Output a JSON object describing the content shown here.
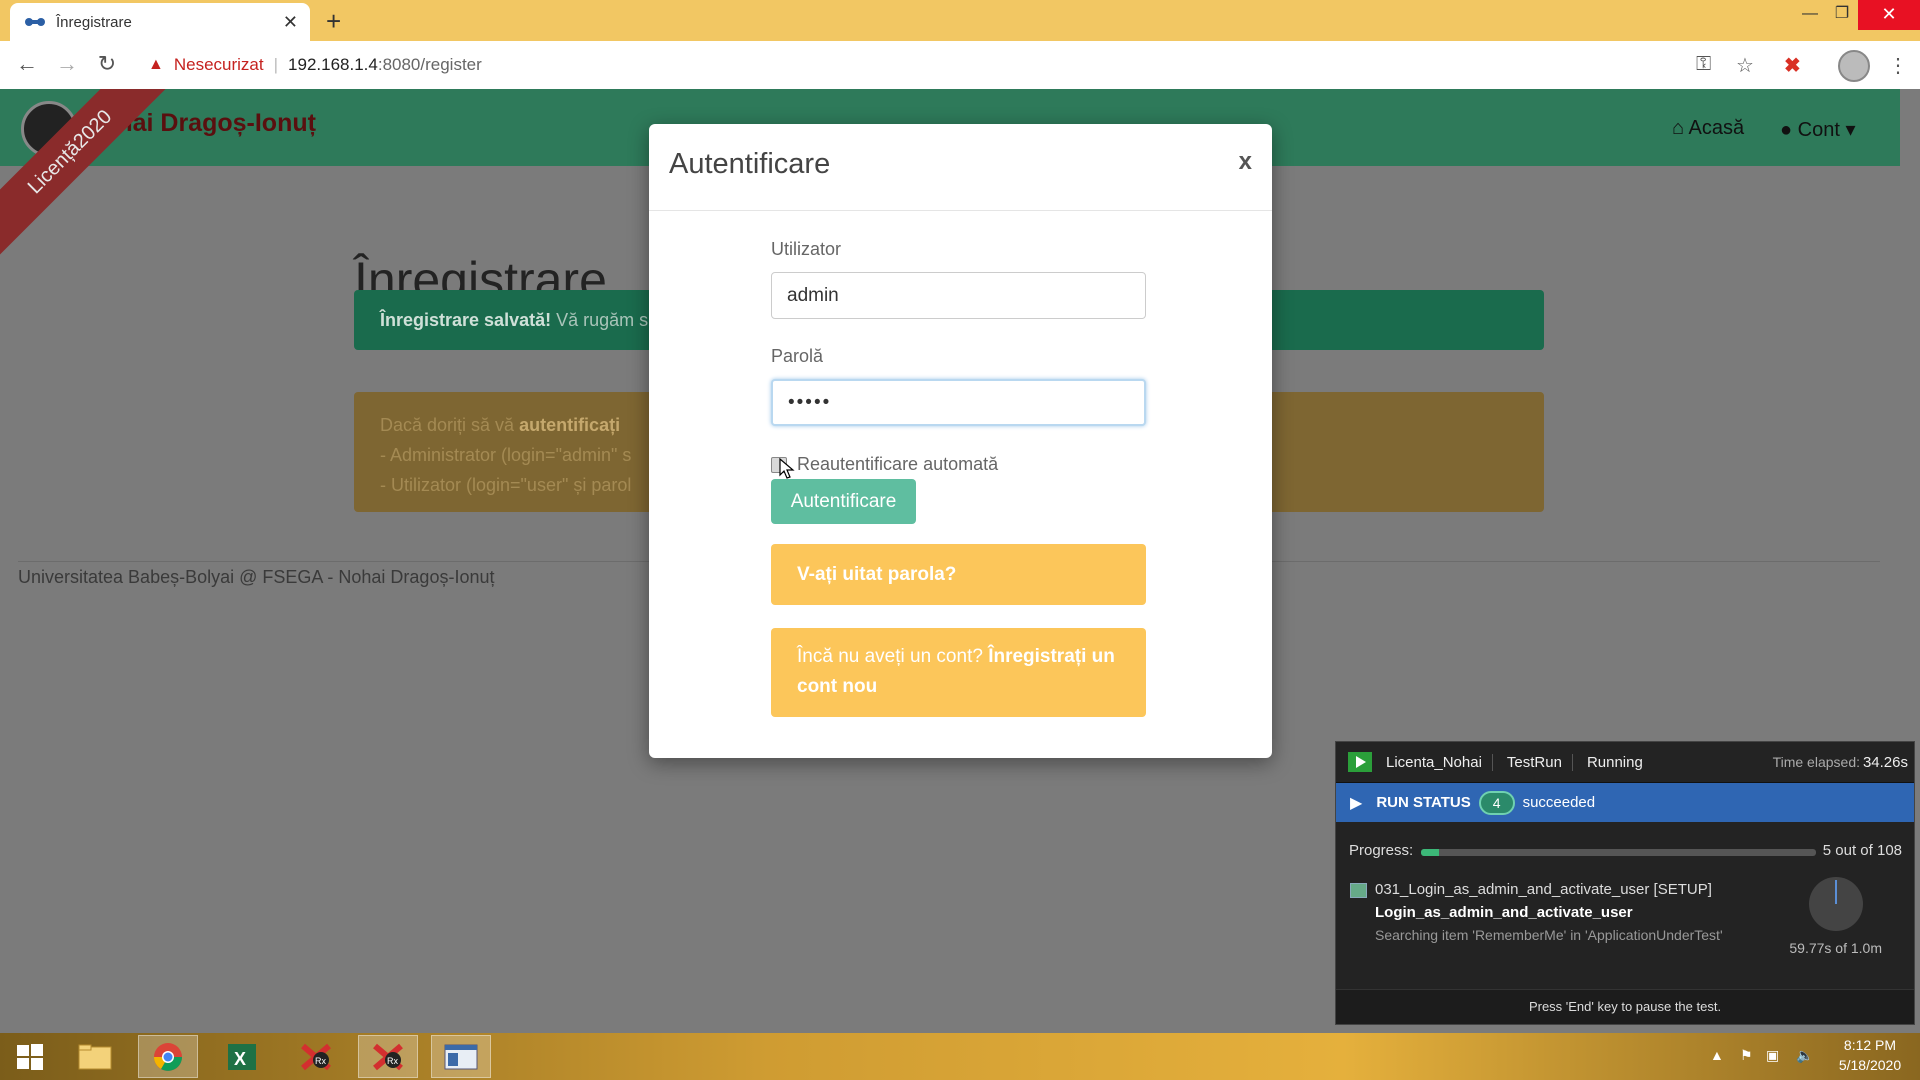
{
  "browser": {
    "tab_title": "Înregistrare",
    "new_tab": "+",
    "tab_close": "✕",
    "security_label": "Nesecurizat",
    "url_host": "192.168.1.4",
    "url_rest": ":8080/register",
    "window_controls": {
      "minimize": "—",
      "maximize": "❐",
      "close": "✕"
    },
    "nav": {
      "back": "←",
      "forward": "→",
      "reload": "↻"
    }
  },
  "site": {
    "brand": "Nohai Dragoș-Ionuț",
    "ribbon": "Licență2020",
    "nav_home": "Acasă",
    "nav_account": "Cont",
    "heading": "Înregistrare",
    "success_bold": "Înregistrare salvată!",
    "success_rest": " Vă rugăm s",
    "warning_line1_pre": "Dacă doriți să vă ",
    "warning_line1_bold": "autentificați",
    "warning_line2": "- Administrator (login=\"admin\" s",
    "warning_line3": "- Utilizator (login=\"user\" și parol",
    "footer": "Universitatea Babeș-Bolyai @ FSEGA - Nohai Dragoș-Ionuț"
  },
  "modal": {
    "title": "Autentificare",
    "close": "x",
    "user_label": "Utilizator",
    "user_value": "admin",
    "password_label": "Parolă",
    "password_value": "•••••",
    "remember_label": "Reautentificare automată",
    "login_button": "Autentificare",
    "forgot_button": "V-ați uitat parola?",
    "register_pre": "Încă nu aveți un cont? ",
    "register_bold": "Înregistrați un cont nou"
  },
  "ranorex": {
    "project": "Licenta_Nohai",
    "run_type": "TestRun",
    "state": "Running",
    "elapsed_label": "Time elapsed:",
    "elapsed_value": "34.26s",
    "run_status_label": "RUN STATUS",
    "succeeded_count": "4",
    "succeeded_label": "succeeded",
    "progress_label": "Progress:",
    "progress_value": "5 out of 108",
    "progress_fraction": 0.046,
    "item_line1": "031_Login_as_admin_and_activate_user [SETUP]",
    "item_line2": "Login_as_admin_and_activate_user",
    "item_line3": "Searching item 'RememberMe' in 'ApplicationUnderTest'",
    "timer_value": "59.77s of 1.0m",
    "footer": "Press 'End' key to pause the test."
  },
  "taskbar": {
    "clock_time": "8:12 PM",
    "clock_date": "5/18/2020"
  },
  "colors": {
    "navbar": "#2e7a5a",
    "success": "#1a6b4d",
    "warning_btn": "#fcc65a",
    "login_btn": "#5fbea0",
    "run_status": "#2f66b3"
  }
}
